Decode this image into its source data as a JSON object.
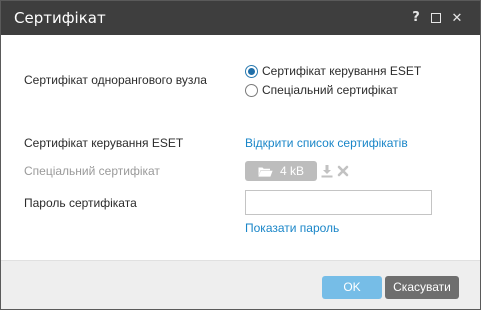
{
  "dialog": {
    "title": "Сертифікат",
    "help_glyph": "?",
    "close_glyph": "✕"
  },
  "form": {
    "peer_cert_label": "Сертифікат однорангового вузла",
    "radio_options": [
      {
        "label": "Сертифікат керування ESET",
        "checked": true
      },
      {
        "label": "Спеціальний сертифікат",
        "checked": false
      }
    ],
    "eset_cert_label": "Сертифікат керування ESET",
    "open_cert_list_link": "Відкрити список сертифікатів",
    "custom_cert_label": "Спеціальний сертифікат",
    "file_size": "4 kB",
    "password_label": "Пароль сертифіката",
    "password_value": "",
    "show_password_link": "Показати пароль"
  },
  "footer": {
    "ok_label": "OK",
    "cancel_label": "Скасувати"
  },
  "colors": {
    "titlebar": "#3e3e3e",
    "link": "#1a86c8",
    "ok_button": "#76bde7",
    "cancel_button": "#6e6e6e",
    "upload_button": "#bdbdbd"
  }
}
